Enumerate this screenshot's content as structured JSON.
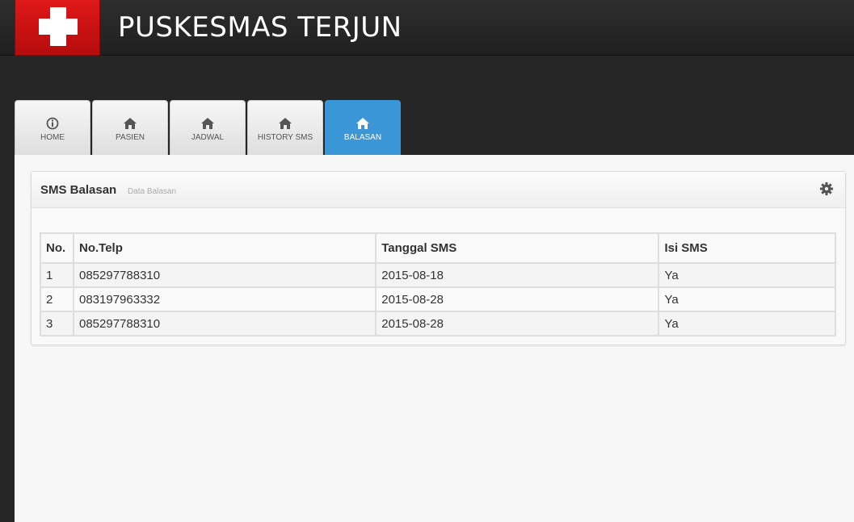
{
  "header": {
    "title": "PUSKESMAS TERJUN",
    "logo_icon": "red-cross-icon"
  },
  "nav": {
    "tabs": [
      {
        "label": "HOME",
        "icon": "info-icon"
      },
      {
        "label": "PASIEN",
        "icon": "home-icon"
      },
      {
        "label": "JADWAL",
        "icon": "home-icon"
      },
      {
        "label": "HISTORY SMS",
        "icon": "home-icon"
      },
      {
        "label": "BALASAN",
        "icon": "home-icon"
      }
    ],
    "active_tab": "BALASAN"
  },
  "panel": {
    "title": "SMS Balasan",
    "subtitle": "Data Balasan",
    "settings_icon": "gear-icon"
  },
  "table": {
    "headers": [
      "No.",
      "No.Telp",
      "Tanggal SMS",
      "Isi SMS"
    ],
    "rows": [
      [
        "1",
        "085297788310",
        "2015-08-18",
        "Ya"
      ],
      [
        "2",
        "083197963332",
        "2015-08-28",
        "Ya"
      ],
      [
        "3",
        "085297788310",
        "2015-08-28",
        "Ya"
      ]
    ]
  },
  "colors": {
    "accent": "#3a96d6",
    "logo_red": "#d41414",
    "topbar": "#262626"
  }
}
